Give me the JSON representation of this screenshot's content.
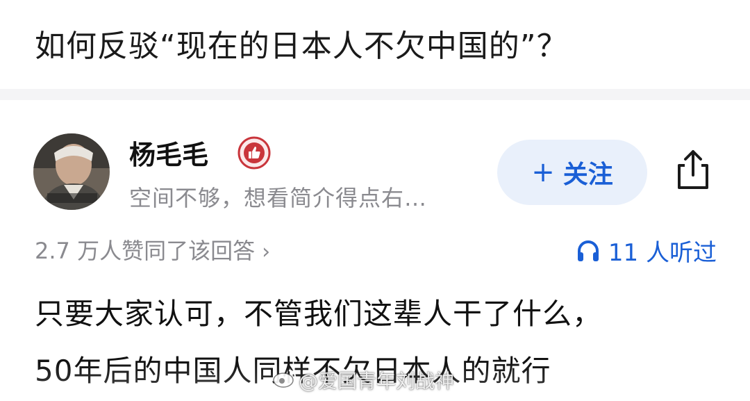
{
  "question": {
    "title": "如何反驳“现在的日本人不欠中国的”？"
  },
  "author": {
    "name": "杨毛毛",
    "bio": "空间不够，想看简介得点右…",
    "badge_icon": "thumbs-up-badge-icon",
    "avatar_icon": "avatar-photo"
  },
  "follow": {
    "plus": "+",
    "label": "关注"
  },
  "share": {
    "icon": "share-icon"
  },
  "stats": {
    "upvotes": "2.7 万人赞同了该回答",
    "chevron": "›",
    "listen_count": "11 人听过",
    "listen_icon": "headphones-icon"
  },
  "answer": {
    "line1": "只要大家认可，不管我们这辈人干了什么，",
    "line2": "50年后的中国人同样不欠日本人的就行"
  },
  "watermark": {
    "text": "@爱国青年刘战神"
  },
  "colors": {
    "accent": "#1a5fd6",
    "follow_bg": "#e9f0fb",
    "muted": "#8a8a8f",
    "badge": "#c9353b"
  }
}
